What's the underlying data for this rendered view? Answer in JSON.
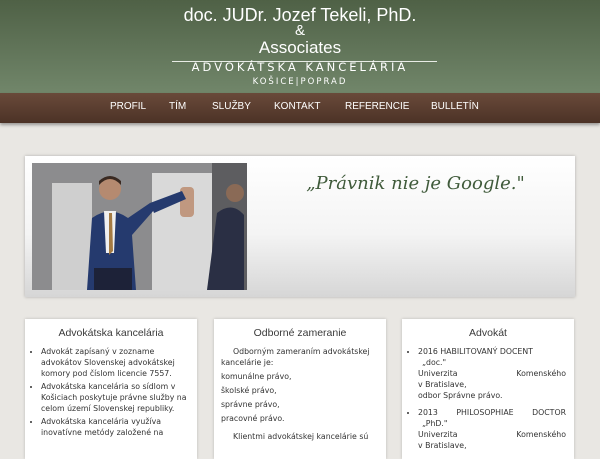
{
  "header": {
    "name": "doc. JUDr. Jozef Tekeli, PhD.",
    "amp": "&",
    "associates": "Associates",
    "subtitle": "ADVOKÁTSKA KANCELÁRIA",
    "cities": "KOŠICE|POPRAD"
  },
  "nav": {
    "items": [
      "PROFIL",
      "TÍM",
      "SLUŽBY",
      "KONTAKT",
      "REFERENCIE",
      "BULLETÍN"
    ],
    "active": "PROFIL"
  },
  "hero": {
    "quote": "„Právnik nie je Google.\""
  },
  "columns": {
    "firm": {
      "title": "Advokátska kancelária",
      "items": [
        "Advokát zapísaný v zozname advokátov Slovenskej advokátskej komory pod číslom licencie 7557.",
        "Advokátska kancelária so sídlom v Košiciach poskytuje právne služby na celom území Slovenskej republiky.",
        "Advokátska kancelária využíva inovatívne metódy založené na"
      ]
    },
    "focus": {
      "title": "Odborné zameranie",
      "intro": "Odborným zameraním advokátskej kancelárie je:",
      "items": [
        "komunálne právo,",
        "školské právo,",
        "správne právo,",
        "pracovné právo."
      ],
      "outro": "Klientmi advokátskej kancelárie sú"
    },
    "lawyer": {
      "title": "Advokát",
      "entry1": {
        "head": "2016 HABILITOVANÝ DOCENT",
        "degree": "„doc.\"",
        "uni_left": "Univerzita",
        "uni_right": "Komenského",
        "city": "v Bratislave,",
        "dept": "odbor Správne právo."
      },
      "entry2": {
        "head_left": "2013",
        "head_mid": "PHILOSOPHIAE",
        "head_right": "DOCTOR",
        "degree": "„PhD.\"",
        "uni_left": "Univerzita",
        "uni_right": "Komenského",
        "city": "v Bratislave,"
      }
    }
  }
}
